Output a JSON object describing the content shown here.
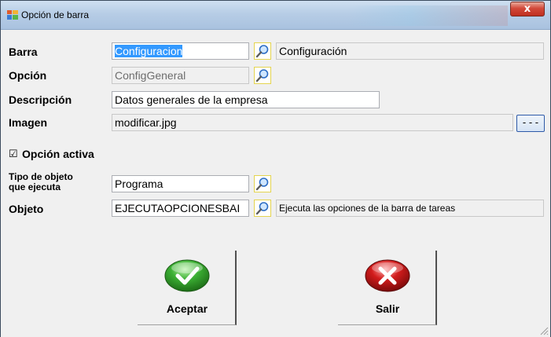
{
  "window": {
    "title": "Opción de barra",
    "close_label": "x"
  },
  "form": {
    "barra": {
      "label": "Barra",
      "value": "Configuracion",
      "description": "Configuración"
    },
    "opcion": {
      "label": "Opción",
      "value": "ConfigGeneral"
    },
    "descripcion": {
      "label": "Descripción",
      "value": "Datos generales de la empresa"
    },
    "imagen": {
      "label": "Imagen",
      "value": "modificar.jpg",
      "browse_label": "- - -"
    },
    "opcion_activa": {
      "label": "Opción activa",
      "checked": true,
      "check_glyph": "☑"
    },
    "tipo_objeto": {
      "label_line1": "Tipo de objeto",
      "label_line2": "que ejecuta",
      "value": "Programa"
    },
    "objeto": {
      "label": "Objeto",
      "value": "EJECUTAOPCIONESBAI",
      "description": "Ejecuta las opciones de la barra de tareas"
    }
  },
  "buttons": {
    "accept": {
      "label": "Aceptar",
      "icon": "check-icon",
      "color": "#3cb034"
    },
    "exit": {
      "label": "Salir",
      "icon": "x-icon",
      "color": "#d21c1c"
    }
  },
  "colors": {
    "selection": "#3399ff",
    "search_border": "#e4d44f",
    "title_gradient": "#b7cde6"
  }
}
